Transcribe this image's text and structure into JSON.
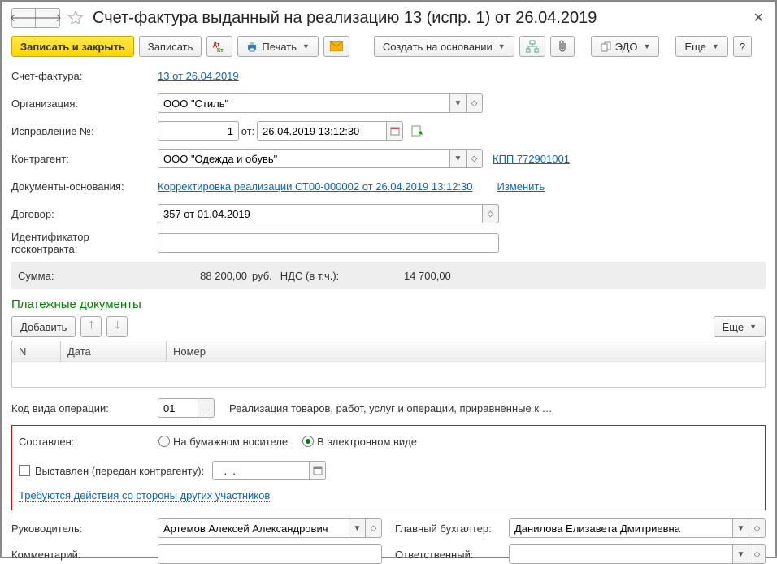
{
  "header": {
    "title": "Счет-фактура выданный на реализацию 13 (испр. 1) от 26.04.2019"
  },
  "toolbar": {
    "save_close": "Записать и закрыть",
    "save": "Записать",
    "print": "Печать",
    "create_based": "Создать на основании",
    "edo": "ЭДО",
    "more": "Еще"
  },
  "fields": {
    "invoice_label": "Счет-фактура:",
    "invoice_link": "13 от 26.04.2019",
    "org_label": "Организация:",
    "org_value": "ООО \"Стиль\"",
    "corr_label": "Исправление №:",
    "corr_value": "1",
    "from_label": "от:",
    "corr_date": "26.04.2019 13:12:30",
    "counterparty_label": "Контрагент:",
    "counterparty_value": "ООО \"Одежда и обувь\"",
    "kpp_link": "КПП 772901001",
    "basis_label": "Документы-основания:",
    "basis_link": "Корректировка реализации СТ00-000002 от 26.04.2019 13:12:30",
    "change_link": "Изменить",
    "contract_label": "Договор:",
    "contract_value": "357 от 01.04.2019",
    "govid_label": "Идентификатор госконтракта:",
    "sum_label": "Сумма:",
    "sum_value": "88 200,00",
    "currency": "руб.",
    "vat_label": "НДС (в т.ч.):",
    "vat_value": "14 700,00"
  },
  "payments": {
    "section": "Платежные документы",
    "add": "Добавить",
    "more": "Еще",
    "col_n": "N",
    "col_date": "Дата",
    "col_num": "Номер"
  },
  "opcode": {
    "label": "Код вида операции:",
    "value": "01",
    "desc": "Реализация товаров, работ, услуг и операции, приравненные к …"
  },
  "composed": {
    "label": "Составлен:",
    "paper": "На бумажном носителе",
    "electronic": "В электронном виде",
    "issued": "Выставлен (передан контрагенту):",
    "issued_date": "  .  .    ",
    "action_required": "Требуются действия со стороны других участников"
  },
  "signers": {
    "head_label": "Руководитель:",
    "head_value": "Артемов Алексей Александрович",
    "acc_label": "Главный бухгалтер:",
    "acc_value": "Данилова Елизавета Дмитриевна",
    "comment_label": "Комментарий:",
    "responsible_label": "Ответственный:"
  }
}
